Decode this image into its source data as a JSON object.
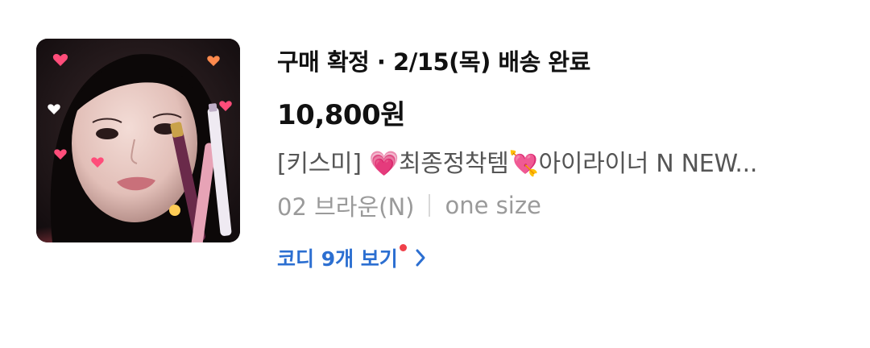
{
  "order": {
    "status_text": "구매 확정 · 2/15(목) 배송 완료",
    "price": "10,800원",
    "product_name": "[키스미] 💗최종정착템💘아이라이너 N NEW...",
    "option_color": "02 브라운(N)",
    "option_size": "one size",
    "codi_link_label": "코디 9개 보기"
  },
  "icons": {
    "product_thumbnail": "product-photo",
    "new_dot": "red-notification-dot",
    "chevron": "chevron-right-icon"
  },
  "colors": {
    "accent_link": "#2c6fd1",
    "notification_dot": "#f0404a",
    "primary_text": "#111111",
    "secondary_text": "#555555",
    "muted_text": "#9a9a9a"
  }
}
